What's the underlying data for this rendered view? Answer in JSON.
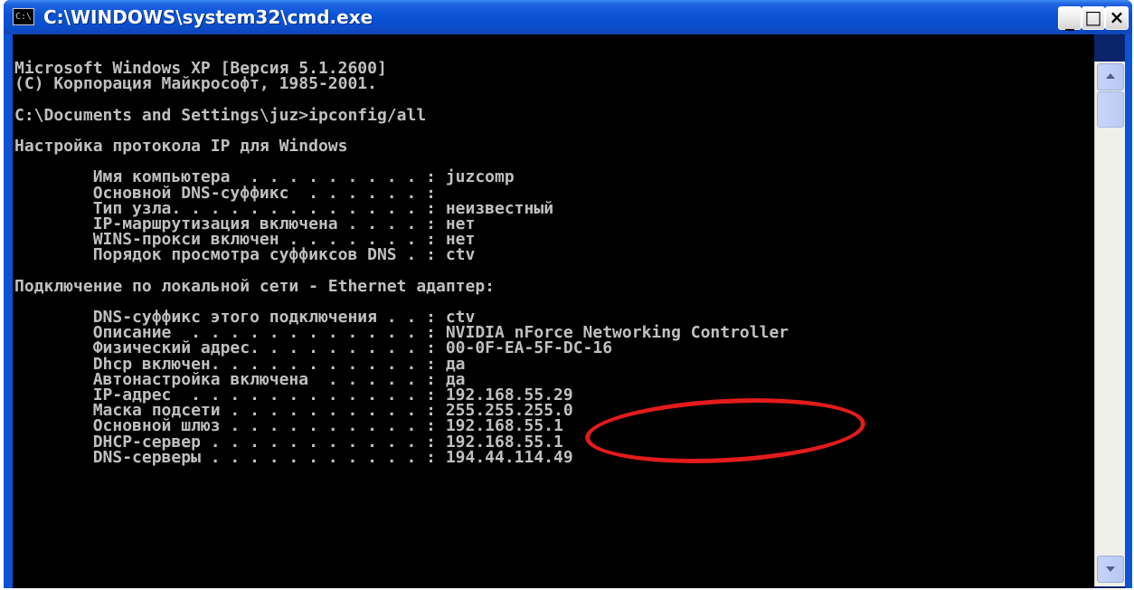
{
  "window": {
    "title": "C:\\WINDOWS\\system32\\cmd.exe",
    "icon_label": "C:\\",
    "controls": {
      "minimize_label": "_",
      "maximize_label": "□",
      "close_label": "×"
    }
  },
  "console": {
    "lines": [
      "Microsoft Windows XP [Версия 5.1.2600]",
      "(С) Корпорация Майкрософт, 1985-2001.",
      "",
      "C:\\Documents and Settings\\juz>ipconfig/all",
      "",
      "Настройка протокола IP для Windows",
      "",
      "        Имя компьютера  . . . . . . . . . : juzcomp",
      "        Основной DNS-суффикс  . . . . . . :",
      "        Тип узла. . . . . . . . . . . . . : неизвестный",
      "        IP-маршрутизация включена . . . . : нет",
      "        WINS-прокси включен . . . . . . . : нет",
      "        Порядок просмотра суффиксов DNS . : ctv",
      "",
      "Подключение по локальной сети - Ethernet адаптер:",
      "",
      "        DNS-суффикс этого подключения . . : ctv",
      "        Описание  . . . . . . . . . . . . : NVIDIA nForce Networking Controller",
      "        Физический адрес. . . . . . . . . : 00-0F-EA-5F-DC-16",
      "        Dhcp включен. . . . . . . . . . . : да",
      "        Автонастройка включена  . . . . . : да",
      "        IP-адрес  . . . . . . . . . . . . : 192.168.55.29",
      "        Маска подсети . . . . . . . . . . : 255.255.255.0",
      "        Основной шлюз . . . . . . . . . . : 192.168.55.1",
      "        DHCP-сервер . . . . . . . . . . . : 192.168.55.1",
      "        DNS-серверы . . . . . . . . . . . : 194.44.114.49"
    ],
    "colors": {
      "background": "#000000",
      "text": "#c0c0c0",
      "highlight": "#e31b1b"
    },
    "highlighted_value": "00-0F-EA-5F-DC-16"
  },
  "scrollbar": {
    "up_icon": "arrow-up-icon",
    "down_icon": "arrow-down-icon"
  }
}
